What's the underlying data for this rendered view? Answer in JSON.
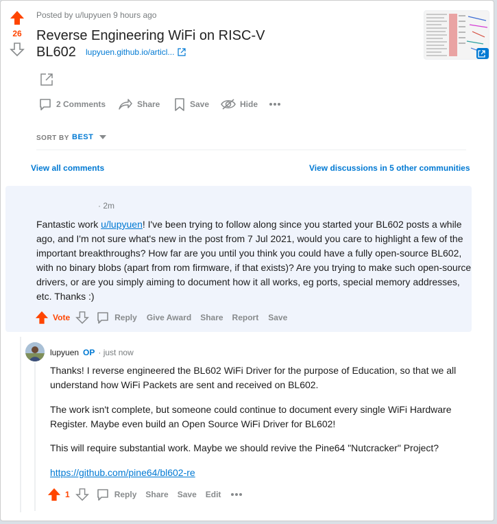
{
  "post": {
    "posted_by": "Posted by u/lupyuen 9 hours ago",
    "votes": "26",
    "title_line1": "Reverse Engineering WiFi on RISC-V",
    "title_line2": "BL602",
    "domain": "lupyuen.github.io/articl...",
    "actions": {
      "comments": "2 Comments",
      "share": "Share",
      "save": "Save",
      "hide": "Hide"
    }
  },
  "sort": {
    "label": "SORT BY",
    "value": "BEST"
  },
  "links": {
    "view_all": "View all comments",
    "view_discussions": "View discussions in 5 other communities"
  },
  "comment1": {
    "time": "· 2m",
    "text_pre": "Fantastic work ",
    "mention": "u/lupyuen",
    "text_post": "! I've been trying to follow along since you started your BL602 posts a while ago, and I'm not sure what's new in the post from 7 Jul 2021, would you care to highlight a few of the important breakthroughs? How far are you until you think you could have a fully open-source BL602, with no binary blobs (apart from rom firmware, if that exists)? Are you trying to make such open-source drivers, or are you simply aiming to document how it all works, eg ports, special memory addresses, etc. Thanks :)",
    "vote": "Vote",
    "actions": [
      "Reply",
      "Give Award",
      "Share",
      "Report",
      "Save"
    ]
  },
  "comment2": {
    "author": "lupyuen",
    "op": "OP",
    "time": "· just now",
    "p1": "Thanks! I reverse engineered the BL602 WiFi Driver for the purpose of Education, so that we all understand how WiFi Packets are sent and received on BL602.",
    "p2": "The work isn't complete, but someone could continue to document every single WiFi Hardware Register. Maybe even build an Open Source WiFi Driver for BL602!",
    "p3": "This will require substantial work. Maybe we should revive the Pine64 \"Nutcracker\" Project?",
    "link": "https://github.com/pine64/bl602-re",
    "votes": "1",
    "actions": [
      "Reply",
      "Share",
      "Save",
      "Edit"
    ]
  },
  "colors": {
    "upvote": "#ff4500",
    "link": "#0079d3",
    "muted": "#878a8c"
  }
}
